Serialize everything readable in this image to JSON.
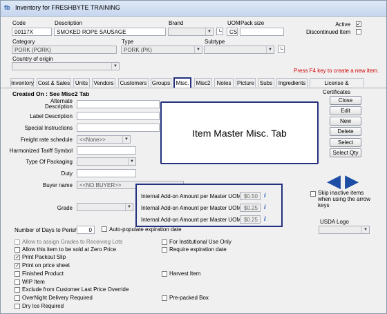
{
  "window": {
    "title": "Inventory for FRESHBYTE TRAINING"
  },
  "header": {
    "code_label": "Code",
    "code_value": "00117X",
    "description_label": "Description",
    "description_value": "SMOKED ROPE SAUSAGE",
    "brand_label": "Brand",
    "uom_label": "UOM",
    "uom_value": "CS",
    "pack_size_label": "Pack size",
    "active_label": "Active",
    "active_checked": "✓",
    "discontinued_label": "Discontinued Item",
    "category_label": "Category",
    "category_value": "PORK (PORK)",
    "type_label": "Type",
    "type_value": "PORK (PK)",
    "subtype_label": "Subtype",
    "country_label": "Country of origin",
    "hint": "Press F4 key  to create a new item."
  },
  "tabs": [
    "Inventory",
    "Cost & Sales",
    "Units",
    "Vendors",
    "Customers",
    "Groups",
    "Misc.",
    "Misc2",
    "Notes",
    "Picture",
    "Subs",
    "Ingredients",
    "License & Certificates"
  ],
  "active_tab": "Misc.",
  "misc": {
    "created_on": "Created On : See Misc2 Tab",
    "alt_desc_label": "Alternate Description",
    "label_desc_label": "Label Description",
    "special_instr_label": "Special Instructions",
    "freight_label": "Freight rate schedule",
    "freight_value": "<<None>>",
    "harmonized_label": "Harmonized Tariff Symbol",
    "packaging_label": "Type Of Packaging",
    "duty_label": "Duty",
    "buyer_label": "Buyer name",
    "buyer_value": "<<NO BUYER>>",
    "grade_label": "Grade",
    "days_perish_label": "Number of Days to Perish",
    "days_perish_value": "0",
    "auto_pop_label": "Auto-populate expiration date",
    "addon": [
      {
        "label": "Internal Add-on Amount per Master UOM #1",
        "value": "$0.50"
      },
      {
        "label": "Internal Add-on Amount per Master UOM #2",
        "value": "$0.25"
      },
      {
        "label": "Internal Add-on Amount per Master UOM #3",
        "value": "$0.25"
      }
    ],
    "info_glyph": "i",
    "skip_inactive_label": "Skip inactive items when using the arrow keys",
    "usda_label": "USDA Logo"
  },
  "callout": "Item Master Misc. Tab",
  "buttons": {
    "close": "Close",
    "edit": "Edit",
    "new": "New",
    "delete": "Delete",
    "select": "Select",
    "select_qty": "Select Qty"
  },
  "checks": {
    "lots": "Allow to assign Grades to Receiving Lots",
    "zero_price": "Allow this item to be sold at Zero Price",
    "packout": "Print Packout Slip",
    "price_sheet": "Print on price sheet",
    "finished": "Finished Product",
    "wip": "WIP Item",
    "exclude": "Exclude from Customer Last Price Override",
    "overnight": "OverNight Delivery Required",
    "dry_ice": "Dry Ice Required",
    "institutional": "For Institutional Use Only",
    "req_exp": "Require expiration date",
    "harvest": "Harvest Item",
    "prepacked": "Pre-packed Box",
    "checked_glyph": "✓"
  }
}
